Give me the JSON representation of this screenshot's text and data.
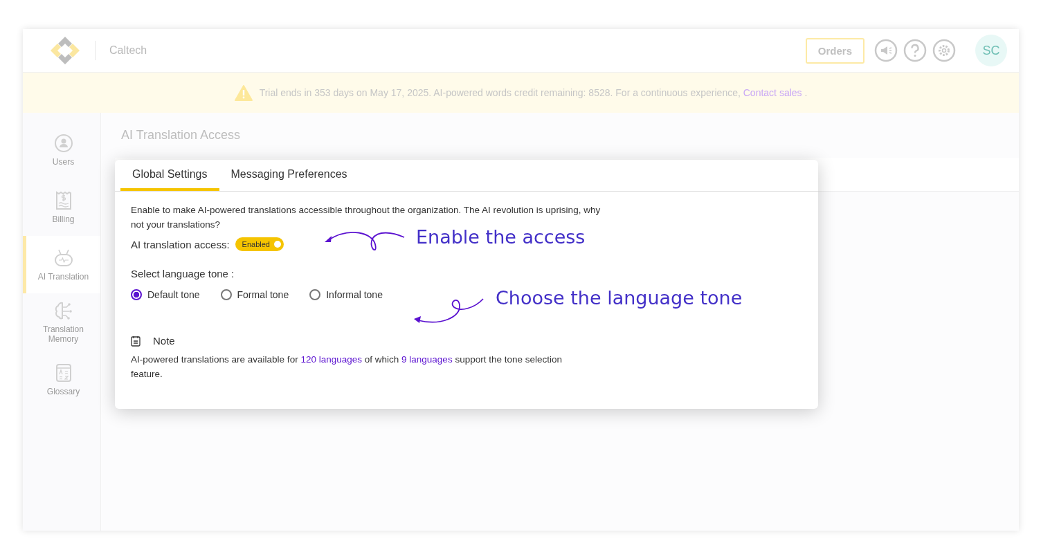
{
  "header": {
    "org": "Caltech",
    "orders_button": "Orders",
    "avatar": "SC"
  },
  "banner": {
    "segments": [
      {
        "kind": "plain",
        "text": "Trial ends in 353 days on May 17, 2025. AI-powered words credit remaining: 8528. For a continuous experience,"
      },
      {
        "kind": "link",
        "text": "Contact sales"
      },
      {
        "kind": "plain",
        "text": "."
      }
    ]
  },
  "sidebar": {
    "items": [
      {
        "kind": "users",
        "label": "Users",
        "selected": false
      },
      {
        "kind": "billing",
        "label": "Billing",
        "selected": false
      },
      {
        "kind": "ai",
        "label": "AI Translation",
        "selected": true
      },
      {
        "kind": "memory",
        "label": "Translation Memory",
        "selected": false
      },
      {
        "kind": "glossary",
        "label": "Glossary",
        "selected": false
      }
    ]
  },
  "page_title": "AI Translation Access",
  "dialog": {
    "tabs": [
      {
        "label": "Global Settings",
        "selected": true
      },
      {
        "label": "Messaging Preferences",
        "selected": false
      }
    ],
    "description": "Enable to make AI-powered translations accessible throughout the organization. The AI revolution is uprising, why not your translations?",
    "access": {
      "label": "AI translation access:",
      "toggle_label": "Enabled",
      "on": true
    },
    "tone_label": "Select language tone :",
    "tones": [
      {
        "label": "Default tone",
        "selected": true
      },
      {
        "label": "Formal tone",
        "selected": false
      },
      {
        "label": "Informal tone",
        "selected": false
      }
    ],
    "note": {
      "title": "Note",
      "segments": [
        {
          "kind": "plain",
          "text": "AI-powered translations are available for"
        },
        {
          "kind": "link",
          "text": "120 languages"
        },
        {
          "kind": "plain",
          "text": "of which"
        },
        {
          "kind": "link",
          "text": "9 languages"
        },
        {
          "kind": "plain",
          "text": "support the tone selection feature."
        }
      ]
    }
  },
  "annotations": [
    {
      "text": "Enable the access"
    },
    {
      "text": "Choose the language tone"
    }
  ]
}
